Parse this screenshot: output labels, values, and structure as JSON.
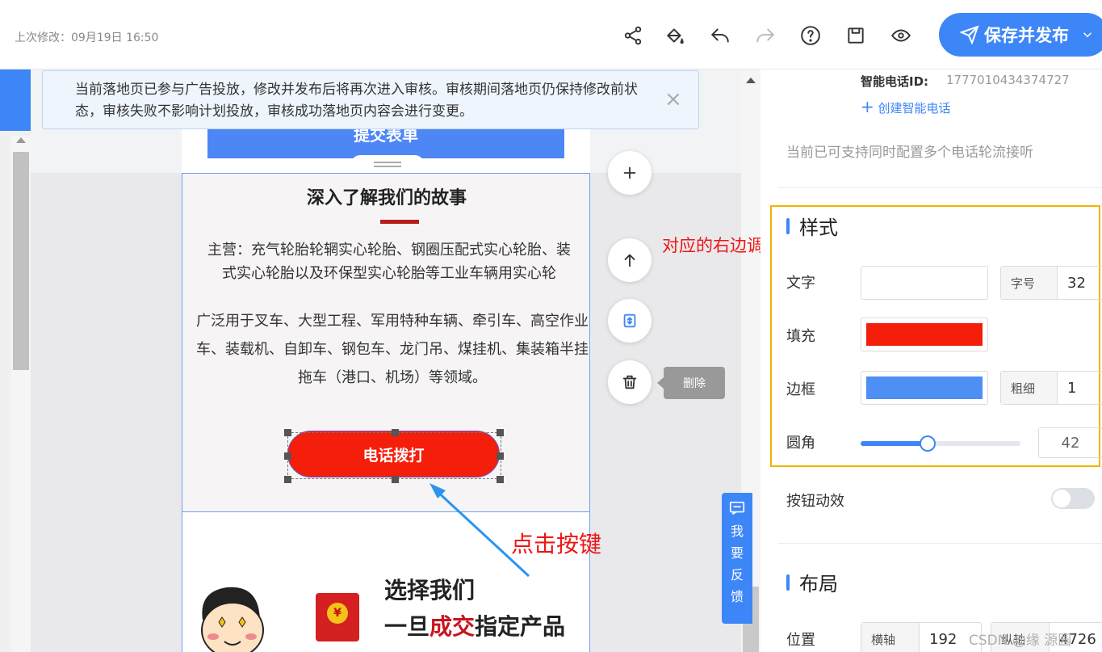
{
  "topbar": {
    "last_modified": "上次修改：09月19日 16:50",
    "publish_label": "保存并发布"
  },
  "icons": [
    "share-icon",
    "fill-bucket-icon",
    "undo-icon",
    "redo-icon",
    "help-icon",
    "save-icon",
    "preview-eye-icon",
    "send-icon",
    "chevron-down-icon"
  ],
  "notice": {
    "text": "当前落地页已参与广告投放，修改并发布后将再次进入审核。审核期间落地页仍保持修改前状态，审核失败不影响计划投放，审核成功落地页内容会进行变更。",
    "close": "×"
  },
  "page": {
    "submit_label": "提交表单",
    "story_title": "深入了解我们的故事",
    "story_p1_line1": "主营：充气轮胎轮辋实心轮胎、钢圈压配式实心轮胎、装",
    "story_p1_line2": "式实心轮胎以及环保型实心轮胎等工业车辆用实心轮",
    "story_p2": "广泛用于叉车、大型工程、军用特种车辆、牵引车、高空作业车、装载机、自卸车、钢包车、龙门吊、煤挂机、集装箱半挂拖车（港口、机场）等领域。",
    "call_button": "电话拨打",
    "choose_line1": "选择我们",
    "choose_line2_a": "一旦",
    "choose_line2_red": "成交",
    "choose_line2_b": "指定产品",
    "coin": "¥"
  },
  "float": {
    "delete_tooltip": "删除"
  },
  "annotations": {
    "right_note": "对应的右边调整边框的形状，背景和文字的颜色",
    "click_note": "点击按键"
  },
  "feedback": {
    "chars": [
      "我",
      "要",
      "反",
      "馈"
    ]
  },
  "panel": {
    "phone_id_label": "智能电话ID:",
    "phone_id_value": "1777010434374727",
    "create_link": "创建智能电话",
    "multi_note": "当前已可支持同时配置多个电话轮流接听",
    "style_title": "样式",
    "text_label": "文字",
    "font_size_label": "字号",
    "font_size_value": "32",
    "fill_label": "填充",
    "fill_color": "#f41e0a",
    "border_label": "边框",
    "border_color": "#4d8ff5",
    "thickness_label": "粗细",
    "thickness_value": "1",
    "radius_label": "圆角",
    "radius_value": "42",
    "radius_fraction": 0.42,
    "animation_label": "按钮动效",
    "animation_on": false,
    "layout_title": "布局",
    "position_label": "位置",
    "x_label": "横轴",
    "x_value": "192",
    "y_label": "纵轴",
    "y_value": "4726"
  },
  "watermark": "CSDN @缘  源园",
  "colors": {
    "accent": "#3d86f7",
    "call_button": "#f41e0a",
    "highlight_box": "#f2b400",
    "annotation": "#f01414"
  }
}
